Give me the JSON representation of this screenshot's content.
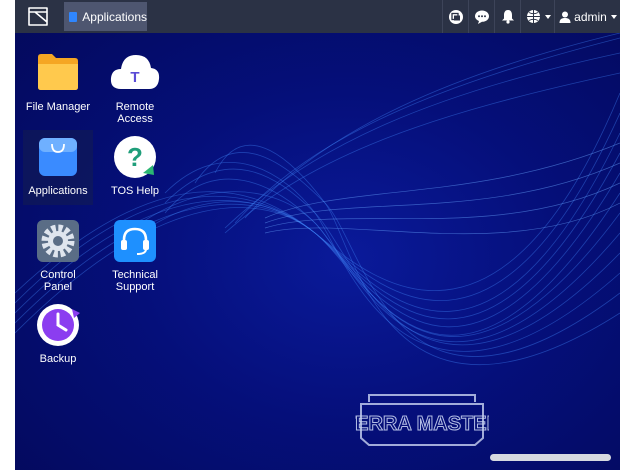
{
  "taskbar": {
    "app_tab_label": "Applications",
    "user_label": "admin",
    "icons": [
      "window-icon",
      "media-icon",
      "chat-icon",
      "bell-icon",
      "globe-icon",
      "user-icon"
    ]
  },
  "desktop": {
    "icons": [
      {
        "label": "File Manager",
        "icon": "folder-icon"
      },
      {
        "label": "Remote Access",
        "icon": "cloud-icon"
      },
      {
        "label": "Applications",
        "icon": "shopping-bag-icon"
      },
      {
        "label": "TOS Help",
        "icon": "help-icon"
      },
      {
        "label": "Control Panel",
        "icon": "gear-icon"
      },
      {
        "label": "Technical Support",
        "icon": "headset-icon"
      },
      {
        "label": "Backup",
        "icon": "clock-icon"
      }
    ]
  },
  "brand": {
    "text": "TERRA MASTER"
  },
  "colors": {
    "taskbar": "#2b3245",
    "desktop": "#050f7a",
    "accent": "#2f86ff"
  }
}
